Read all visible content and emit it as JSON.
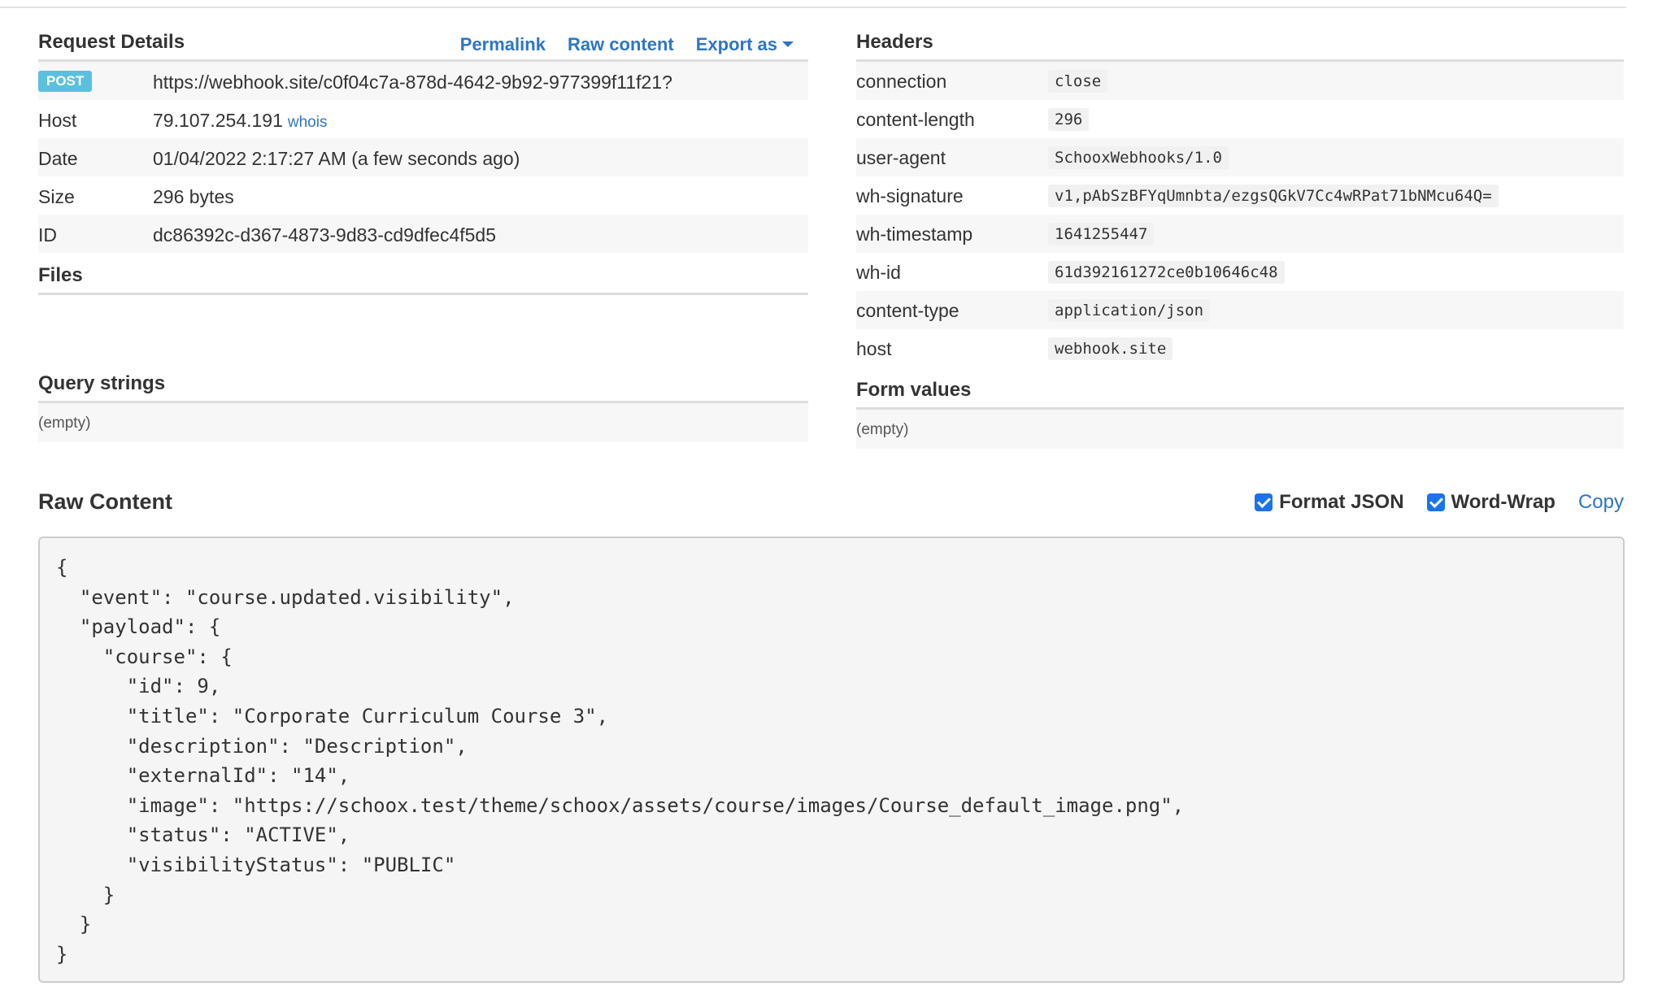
{
  "request_details": {
    "title": "Request Details",
    "links": {
      "permalink": "Permalink",
      "raw_content": "Raw content",
      "export_as": "Export as"
    },
    "method": "POST",
    "url": "https://webhook.site/c0f04c7a-878d-4642-9b92-977399f11f21?",
    "host_label": "Host",
    "host_value": "79.107.254.191",
    "whois": "whois",
    "date_label": "Date",
    "date_value": "01/04/2022 2:17:27 AM (a few seconds ago)",
    "size_label": "Size",
    "size_value": "296 bytes",
    "id_label": "ID",
    "id_value": "dc86392c-d367-4873-9d83-cd9dfec4f5d5"
  },
  "files": {
    "title": "Files"
  },
  "headers": {
    "title": "Headers",
    "items": [
      {
        "key": "connection",
        "value": "close"
      },
      {
        "key": "content-length",
        "value": "296"
      },
      {
        "key": "user-agent",
        "value": "SchooxWebhooks/1.0"
      },
      {
        "key": "wh-signature",
        "value": "v1,pAbSzBFYqUmnbta/ezgsQGkV7Cc4wRPat71bNMcu64Q="
      },
      {
        "key": "wh-timestamp",
        "value": "1641255447"
      },
      {
        "key": "wh-id",
        "value": "61d392161272ce0b10646c48"
      },
      {
        "key": "content-type",
        "value": "application/json"
      },
      {
        "key": "host",
        "value": "webhook.site"
      }
    ]
  },
  "query_strings": {
    "title": "Query strings",
    "empty": "(empty)"
  },
  "form_values": {
    "title": "Form values",
    "empty": "(empty)"
  },
  "raw_content": {
    "title": "Raw Content",
    "format_json": "Format JSON",
    "word_wrap": "Word-Wrap",
    "copy": "Copy",
    "body": "{\n  \"event\": \"course.updated.visibility\",\n  \"payload\": {\n    \"course\": {\n      \"id\": 9,\n      \"title\": \"Corporate Curriculum Course 3\",\n      \"description\": \"Description\",\n      \"externalId\": \"14\",\n      \"image\": \"https://schoox.test/theme/schoox/assets/course/images/Course_default_image.png\",\n      \"status\": \"ACTIVE\",\n      \"visibilityStatus\": \"PUBLIC\"\n    }\n  }\n}"
  }
}
